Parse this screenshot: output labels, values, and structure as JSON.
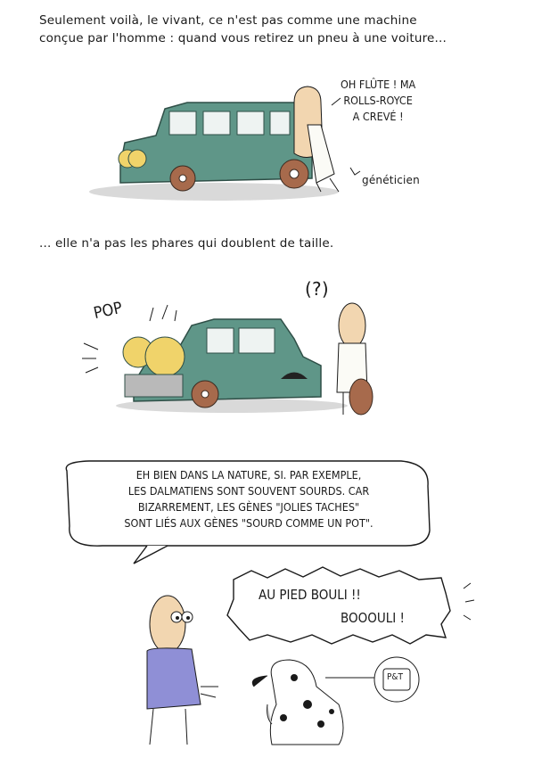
{
  "captions": {
    "intro_line1": "Seulement voilà, le vivant, ce n'est pas comme une machine",
    "intro_line2": "conçue par l'homme : quand vous retirez un pneu à une voiture...",
    "second": "... elle n'a pas les phares qui doublent de taille."
  },
  "panel1": {
    "speech_line1": "OH FLÛTE ! MA",
    "speech_line2": "ROLLS-ROYCE",
    "speech_line3": "A CREVÉ !",
    "label": "généticien"
  },
  "panel2": {
    "sound": "POP",
    "thought": "(?)"
  },
  "panel3": {
    "speech_line1": "EH BIEN DANS LA NATURE, SI. PAR EXEMPLE,",
    "speech_line2": "LES DALMATIENS SONT SOUVENT SOURDS. CAR",
    "speech_line3": "BIZARREMENT, LES GÈNES \"JOLIES TACHES\"",
    "speech_line4": "SONT LIÉS AUX GÈNES \"SOURD COMME UN POT\".",
    "shout_line1": "AU PIED BOULI !!",
    "shout_line2": "BOOOULI !",
    "pot_label": "P&T"
  },
  "colors": {
    "car": "#5f9688",
    "car_dark": "#3f6f64",
    "tire": "#a76a4c",
    "headlight": "#f0d36a",
    "skin": "#f2d6b0",
    "shirt": "#8f8fd6",
    "ink": "#1a1a1a"
  }
}
